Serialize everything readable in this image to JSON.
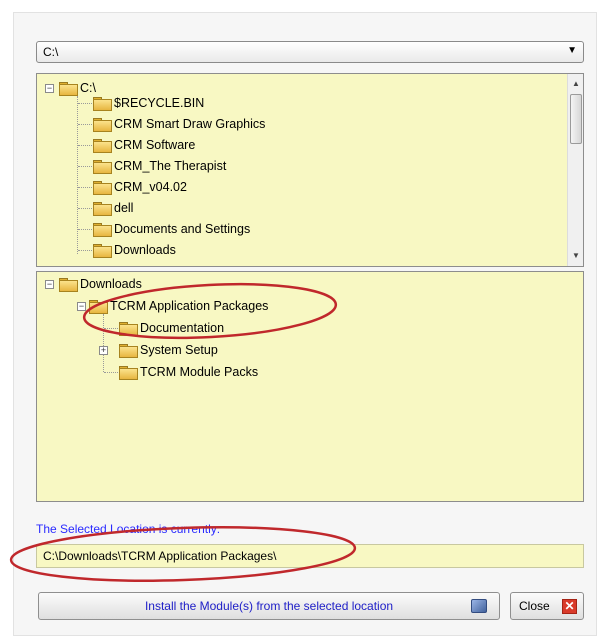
{
  "drive_select": {
    "value": "C:\\"
  },
  "top_tree": {
    "root": "C:\\",
    "items": [
      "$RECYCLE.BIN",
      "CRM Smart Draw Graphics",
      "CRM Software",
      "CRM_The Therapist",
      "CRM_v04.02",
      "dell",
      "Documents and Settings",
      "Downloads"
    ]
  },
  "bottom_tree": {
    "root": "Downloads",
    "selected": "TCRM Application Packages",
    "children": [
      "Documentation",
      "System Setup",
      "TCRM Module Packs"
    ]
  },
  "status": {
    "label": "The Selected Location is currently:",
    "path": "C:\\Downloads\\TCRM Application Packages\\"
  },
  "buttons": {
    "install": "Install the Module(s) from the selected location",
    "close": "Close"
  },
  "colors": {
    "tree_bg": "#f8f8c3",
    "link_text": "#2a2aff",
    "annotation": "#c0282c"
  },
  "icons": {
    "folder": "folder-icon",
    "install": "disk-icon",
    "close": "close-icon"
  }
}
